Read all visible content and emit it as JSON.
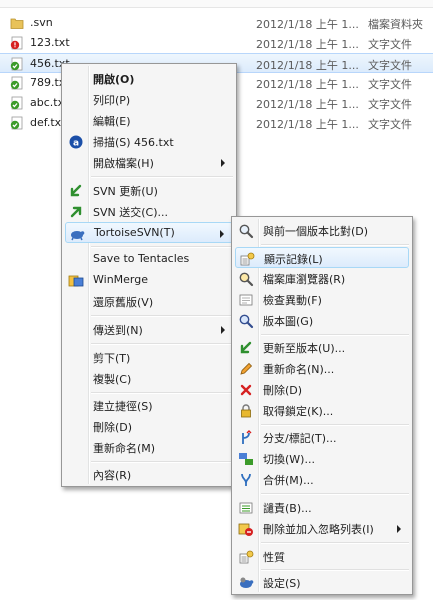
{
  "files": [
    {
      "name": ".svn",
      "date": "2012/1/18 上午 1...",
      "type": "檔案資料夾",
      "icon": "folder-icon"
    },
    {
      "name": "123.txt",
      "date": "2012/1/18 上午 1...",
      "type": "文字文件",
      "icon": "svn-conflict-icon"
    },
    {
      "name": "456.txt",
      "date": "2012/1/18 上午 1...",
      "type": "文字文件",
      "icon": "svn-normal-icon"
    },
    {
      "name": "789.txt",
      "date": "2012/1/18 上午 1...",
      "type": "文字文件",
      "icon": "svn-normal-icon"
    },
    {
      "name": "abc.txt",
      "date": "2012/1/18 上午 1...",
      "type": "文字文件",
      "icon": "svn-normal-icon"
    },
    {
      "name": "def.txt",
      "date": "2012/1/18 上午 1...",
      "type": "文字文件",
      "icon": "svn-normal-icon"
    }
  ],
  "context_menu": {
    "open": "開啟(O)",
    "print": "列印(P)",
    "edit": "編輯(E)",
    "scan": "掃描(S) 456.txt",
    "open_with": "開啟檔案(H)",
    "svn_update": "SVN 更新(U)",
    "svn_commit": "SVN 送交(C)...",
    "tortoise_svn": "TortoiseSVN(T)",
    "save_to_tentacles": "Save to Tentacles",
    "winmerge": "WinMerge",
    "restore_previous": "還原舊版(V)",
    "send_to": "傳送到(N)",
    "cut": "剪下(T)",
    "copy": "複製(C)",
    "create_shortcut": "建立捷徑(S)",
    "delete": "刪除(D)",
    "rename": "重新命名(M)",
    "properties": "內容(R)"
  },
  "tortoise_submenu": {
    "diff_previous": "與前一個版本比對(D)",
    "show_log": "顯示記錄(L)",
    "repo_browser": "檔案庫瀏覽器(R)",
    "check_modifications": "檢查異動(F)",
    "revision_graph": "版本圖(G)",
    "update_to_revision": "更新至版本(U)...",
    "rename": "重新命名(N)...",
    "delete": "刪除(D)",
    "get_lock": "取得鎖定(K)...",
    "branch_tag": "分支/標記(T)...",
    "switch": "切換(W)...",
    "merge": "合併(M)...",
    "blame": "譴責(B)...",
    "ignore": "刪除並加入忽略列表(I)",
    "properties": "性質",
    "settings": "設定(S)"
  },
  "colors": {
    "svn_normal": "#3c9b2a",
    "svn_conflict": "#d62020",
    "folder": "#e8c25a",
    "selection_border": "#a8d8f6"
  }
}
